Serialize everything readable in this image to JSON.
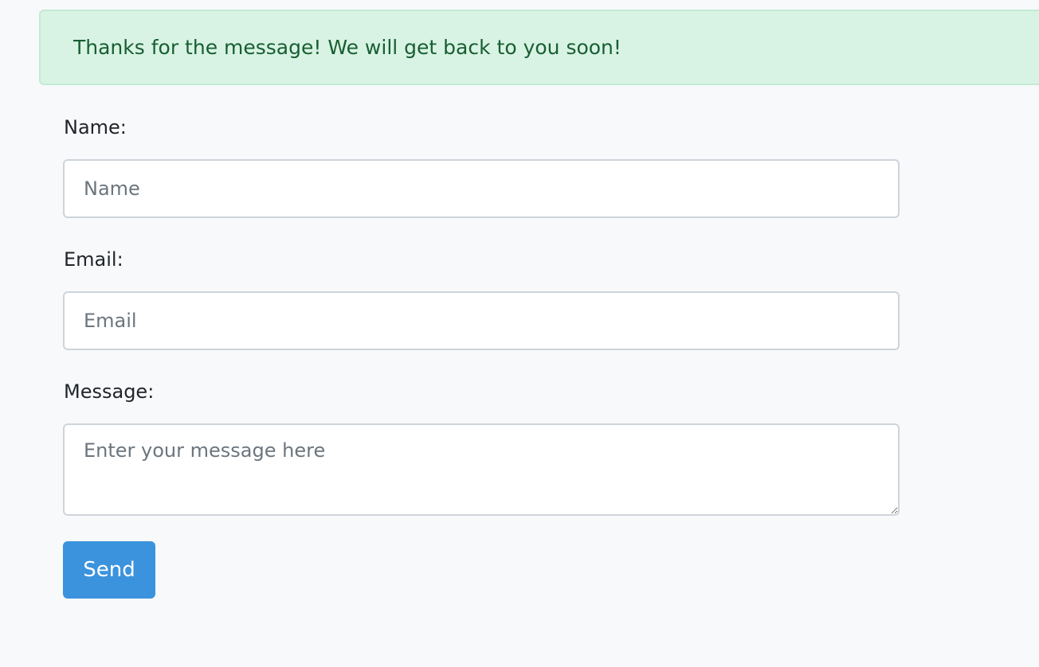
{
  "alert": {
    "message": "Thanks for the message! We will get back to you soon!"
  },
  "form": {
    "name_label": "Name:",
    "name_placeholder": "Name",
    "email_label": "Email:",
    "email_placeholder": "Email",
    "message_label": "Message:",
    "message_placeholder": "Enter your message here",
    "send_label": "Send"
  },
  "colors": {
    "background": "#f8f9fb",
    "alert_bg": "#d8f3e3",
    "alert_text": "#185e33",
    "button_bg": "#3b93dd"
  }
}
